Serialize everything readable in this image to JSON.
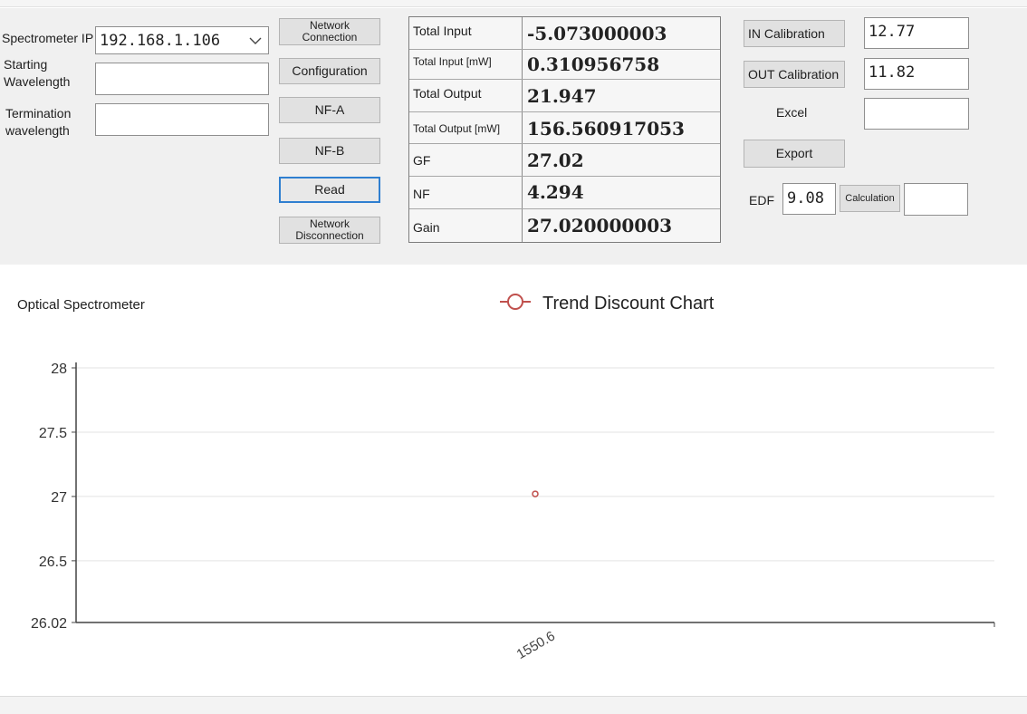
{
  "controls": {
    "spectrometer_ip_label": "Spectrometer IP",
    "spectrometer_ip_value": "192.168.1.106",
    "starting_wavelength_label": "Starting\nWavelength",
    "starting_wavelength_value": "",
    "termination_wavelength_label": "Termination\nwavelength",
    "termination_wavelength_value": ""
  },
  "buttons": {
    "network_connection": "Network\nConnection",
    "configuration": "Configuration",
    "nf_a": "NF-A",
    "nf_b": "NF-B",
    "read": "Read",
    "network_disconnection": "Network\nDisconnection",
    "in_calibration": "IN Calibration",
    "out_calibration": "OUT Calibration",
    "export": "Export",
    "calculation": "Calculation"
  },
  "results": {
    "rows": [
      {
        "label": "Total Input",
        "value": "-5.073000003"
      },
      {
        "label": "Total Input [mW]",
        "value": "0.310956758"
      },
      {
        "label": "Total Output",
        "value": "21.947"
      },
      {
        "label": "Total Output [mW]",
        "value": "156.560917053"
      },
      {
        "label": "GF",
        "value": "27.02"
      },
      {
        "label": "NF",
        "value": "4.294"
      },
      {
        "label": "Gain",
        "value": "27.020000003"
      }
    ]
  },
  "right_panel": {
    "in_calibration_value": "12.77",
    "out_calibration_value": "11.82",
    "excel_label": "Excel",
    "excel_value": "",
    "edf_label": "EDF",
    "edf_value": "9.08",
    "calculation_result": ""
  },
  "chart_title": "Optical Spectrometer",
  "chart_data": {
    "type": "line",
    "title": "",
    "legend": {
      "label": "Trend Discount Chart",
      "placement": "top-center"
    },
    "series": [
      {
        "name": "Trend Discount Chart",
        "x": [
          "1550.6"
        ],
        "values": [
          27.02
        ]
      }
    ],
    "categories": [
      "1550.6"
    ],
    "yticks": [
      26.02,
      26.5,
      27,
      27.5,
      28
    ],
    "ylim": [
      26.02,
      28
    ],
    "grid": true,
    "xlabel": "",
    "ylabel": "",
    "colors": {
      "series": "#c0504d",
      "grid": "#e3e3e3",
      "axis": "#444444"
    }
  }
}
